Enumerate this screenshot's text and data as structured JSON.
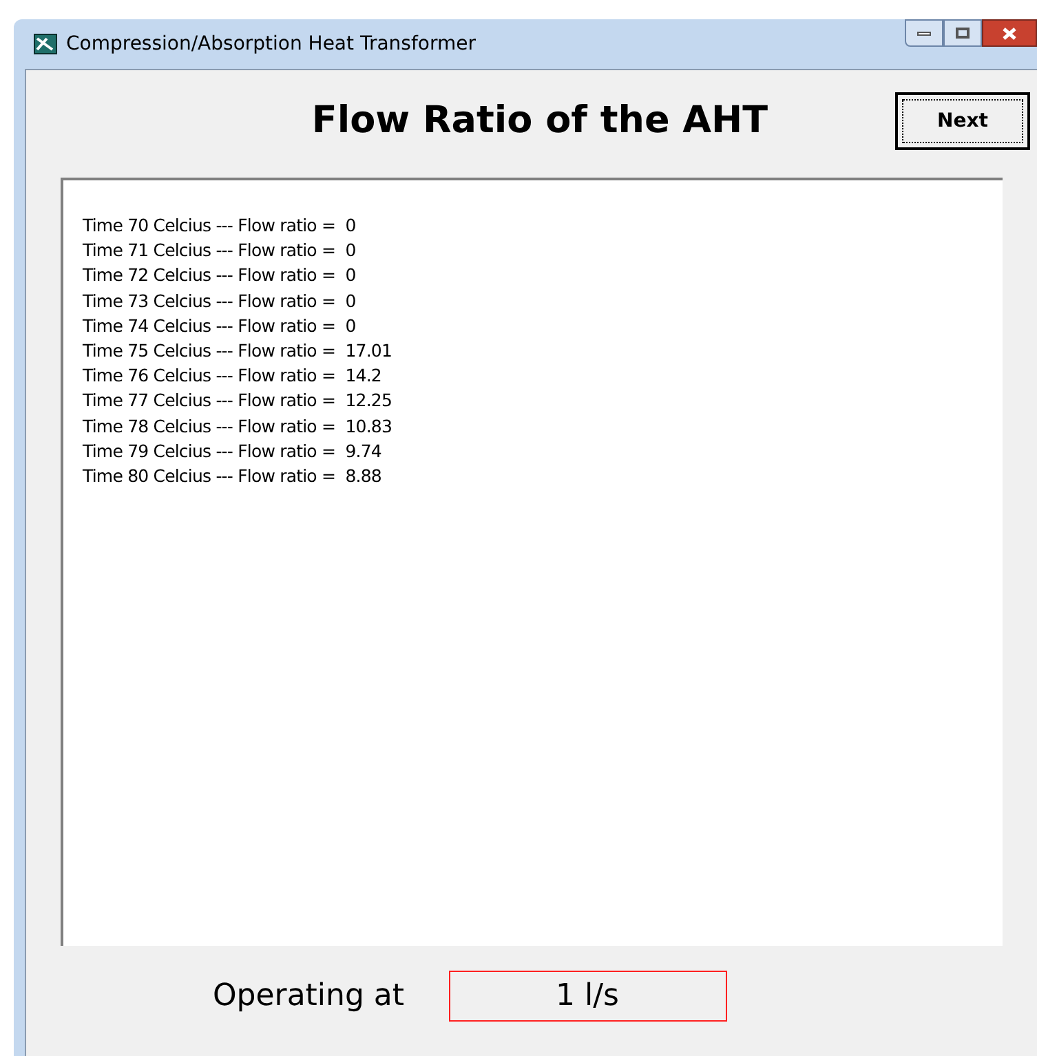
{
  "window": {
    "title": "Compression/Absorption Heat Transformer"
  },
  "heading": "Flow Ratio of the AHT",
  "next_button": "Next",
  "results": [
    "Time 70 Celcius --- Flow ratio =  0",
    "Time 71 Celcius --- Flow ratio =  0",
    "Time 72 Celcius --- Flow ratio =  0",
    "Time 73 Celcius --- Flow ratio =  0",
    "Time 74 Celcius --- Flow ratio =  0",
    "Time 75 Celcius --- Flow ratio =  17.01",
    "Time 76 Celcius --- Flow ratio =  14.2",
    "Time 77 Celcius --- Flow ratio =  12.25",
    "Time 78 Celcius --- Flow ratio =  10.83",
    "Time 79 Celcius --- Flow ratio =  9.74",
    "Time 80 Celcius --- Flow ratio =  8.88"
  ],
  "operating": {
    "label": "Operating at",
    "value": "1 l/s"
  }
}
